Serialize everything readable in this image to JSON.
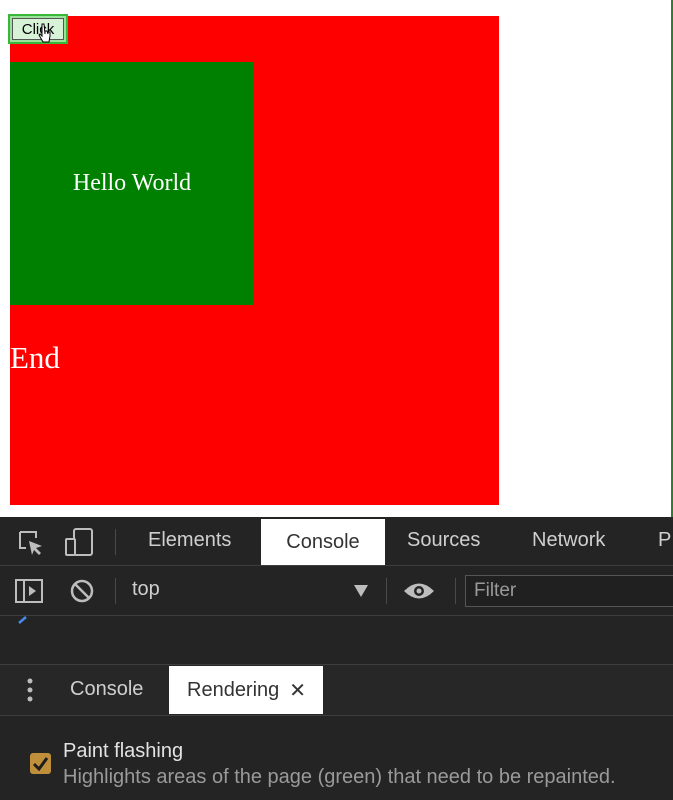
{
  "page": {
    "button_label": "Click",
    "box_text": "Hello World",
    "end_text": "End"
  },
  "devtools": {
    "tabs": [
      "Elements",
      "Console",
      "Sources",
      "Network",
      "P"
    ],
    "active_tab": "Console",
    "context_select": "top",
    "filter_placeholder": "Filter",
    "drawer_tabs": [
      "Console",
      "Rendering"
    ],
    "active_drawer_tab": "Rendering",
    "close_glyph": "✕",
    "paint_flashing": {
      "label": "Paint flashing",
      "description": "Highlights areas of the page (green) that need to be repainted.",
      "checked": true
    }
  },
  "colors": {
    "outer_box": "#ff0000",
    "inner_box": "#008000",
    "devtools_bg": "#242424",
    "checkbox": "#c08f3b",
    "paint_flash_highlight": "#9be09b"
  },
  "icons": [
    "inspect-element-icon",
    "device-toolbar-icon",
    "sidebar-toggle-icon",
    "clear-console-icon",
    "dropdown-arrow-icon",
    "eye-icon",
    "more-vertical-icon",
    "close-icon",
    "cursor-pointer-icon",
    "checkmark-icon"
  ]
}
